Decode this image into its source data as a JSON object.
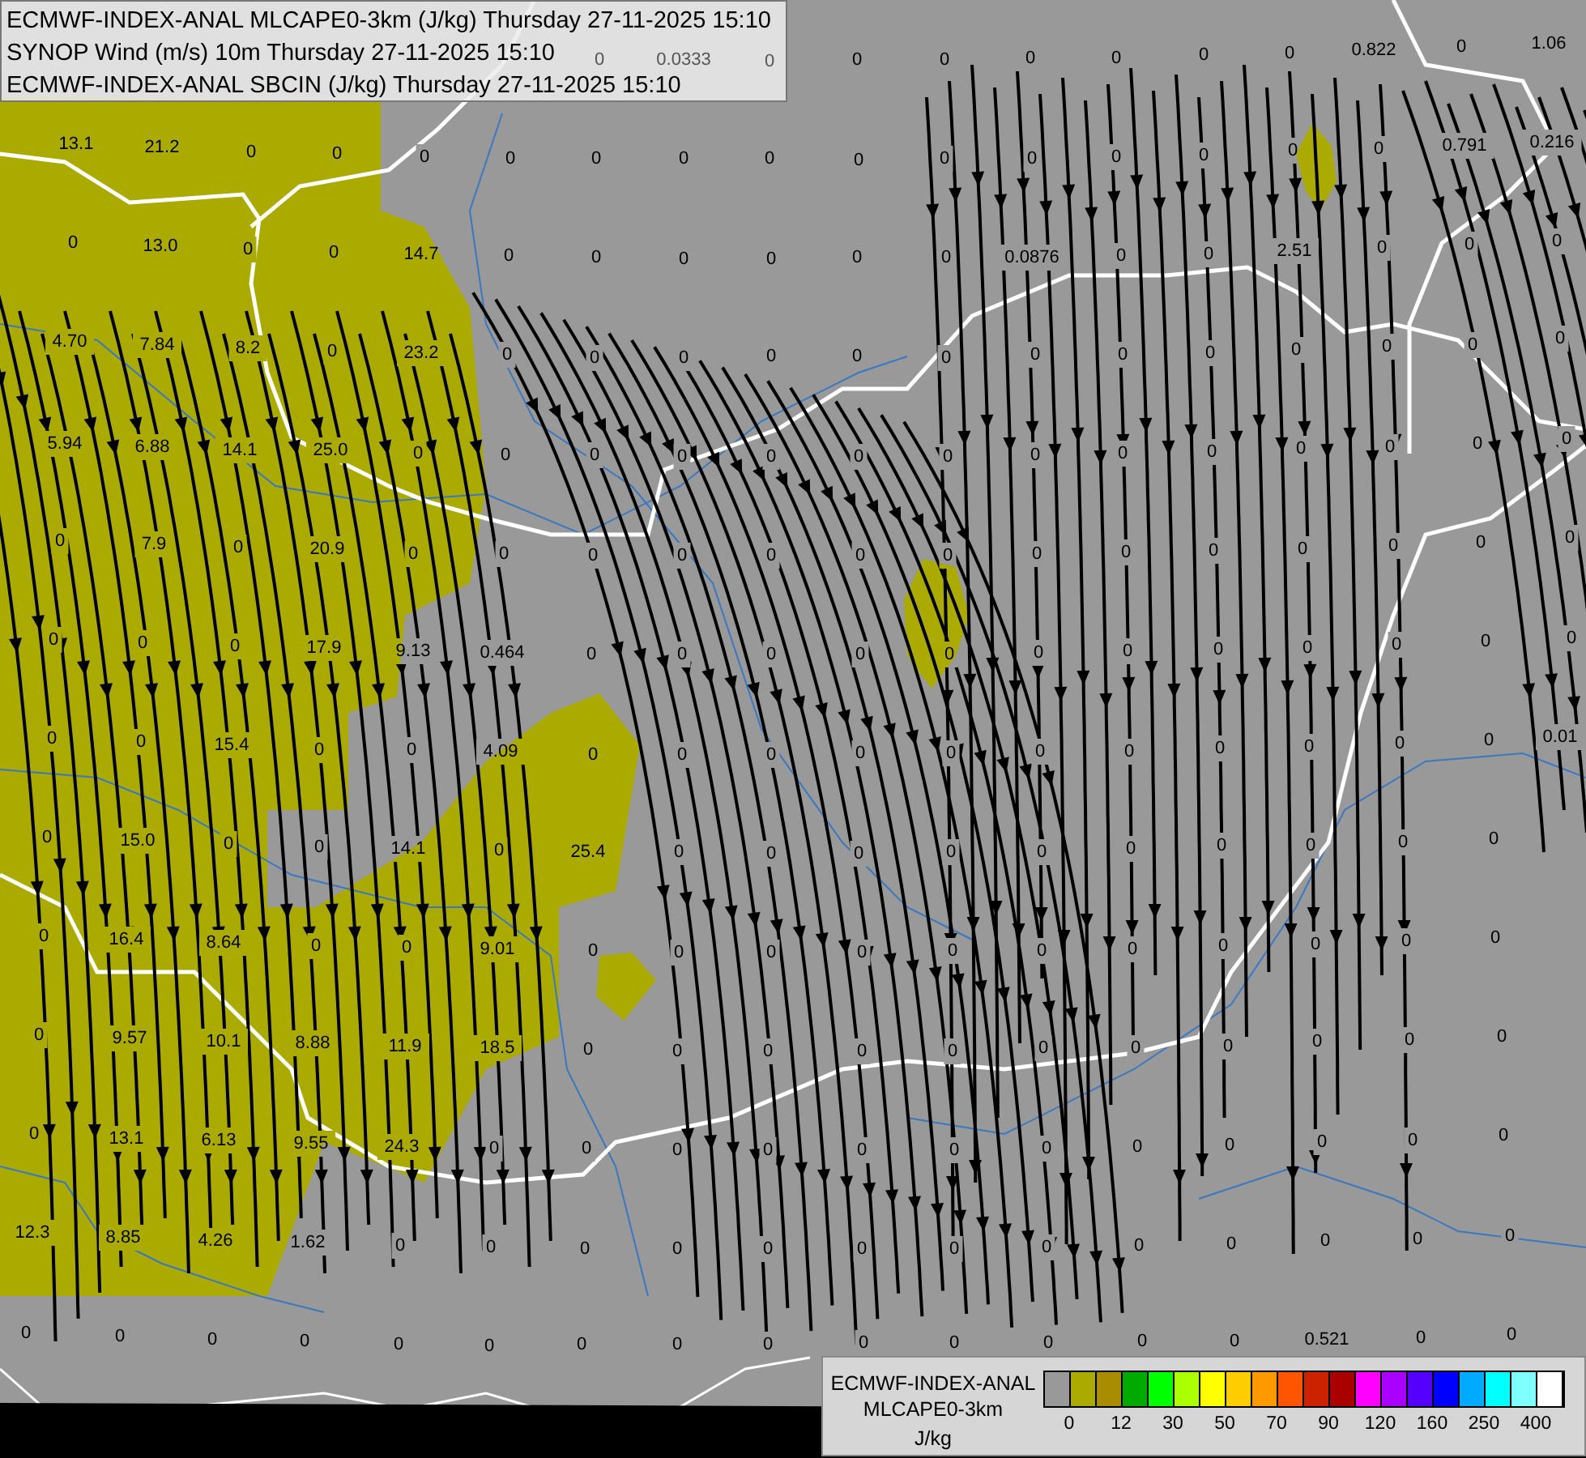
{
  "header": {
    "lines": [
      "ECMWF-INDEX-ANAL MLCAPE0-3km (J/kg) Thursday 27-11-2025 15:10",
      "SYNOP Wind (m/s) 10m Thursday 27-11-2025 15:10",
      "ECMWF-INDEX-ANAL SBCIN (J/kg) Thursday 27-11-2025 15:10"
    ]
  },
  "map": {
    "values": [
      [
        "0",
        "0.0333",
        "0"
      ],
      [
        "0",
        "0",
        "0",
        "0",
        "0",
        "0",
        "0.822",
        "0",
        "1.06"
      ],
      [
        "13.1",
        "21.2",
        "0",
        "0",
        "0",
        "0",
        "0",
        "0",
        "0",
        "0",
        "0",
        "0",
        "0",
        "0",
        "0",
        "0",
        "0.791",
        "0.216"
      ],
      [
        "0",
        "13.0",
        "0",
        "0",
        "14.7",
        "0",
        "0",
        "0",
        "0",
        "0",
        "0",
        "0.0876",
        "0",
        "0",
        "2.51",
        "0",
        "0",
        "0"
      ],
      [
        "4.70",
        "7.84",
        "8.2",
        "0",
        "23.2",
        "0",
        "0",
        "0",
        "0",
        "0",
        "0",
        "0",
        "0",
        "0",
        "0",
        "0",
        "0",
        "0"
      ],
      [
        "5.94",
        "6.88",
        "14.1",
        "25.0",
        "0",
        "0",
        "0",
        "0",
        "0",
        "0",
        "0",
        "0",
        "0",
        "0",
        "0",
        "0",
        "0",
        "0"
      ],
      [
        "0",
        "7.9",
        "0",
        "20.9",
        "0",
        "0",
        "0",
        "0",
        "0",
        "0",
        "0",
        "0",
        "0",
        "0",
        "0",
        "0",
        "0",
        "0"
      ],
      [
        "0",
        "0",
        "0",
        "17.9",
        "9.13",
        "0.464",
        "0",
        "0",
        "0",
        "0",
        "0",
        "0",
        "0",
        "0",
        "0",
        "0",
        "0",
        "0"
      ],
      [
        "0",
        "0",
        "15.4",
        "0",
        "0",
        "4.09",
        "0",
        "0",
        "0",
        "0",
        "0",
        "0",
        "0",
        "0",
        "0",
        "0",
        "0",
        "0.01"
      ],
      [
        "0",
        "15.0",
        "0",
        "0",
        "14.1",
        "0",
        "25.4",
        "0",
        "0",
        "0",
        "0",
        "0",
        "0",
        "0",
        "0",
        "0",
        "0"
      ],
      [
        "0",
        "16.4",
        "8.64",
        "0",
        "0",
        "9.01",
        "0",
        "0",
        "0",
        "0",
        "0",
        "0",
        "0",
        "0",
        "0",
        "0",
        "0"
      ],
      [
        "0",
        "9.57",
        "10.1",
        "8.88",
        "11.9",
        "18.5",
        "0",
        "0",
        "0",
        "0",
        "0",
        "0",
        "0",
        "0",
        "0",
        "0",
        "0"
      ],
      [
        "0",
        "13.1",
        "6.13",
        "9.55",
        "24.3",
        "0",
        "0",
        "0",
        "0",
        "0",
        "0",
        "0",
        "0",
        "0",
        "0",
        "0",
        "0"
      ],
      [
        "12.3",
        "8.85",
        "4.26",
        "1.62",
        "0",
        "0",
        "0",
        "0",
        "0",
        "0",
        "0",
        "0",
        "0",
        "0",
        "0",
        "0",
        "0"
      ],
      [
        "0",
        "0",
        "0",
        "0",
        "0",
        "0",
        "0",
        "0",
        "0",
        "0",
        "0",
        "0",
        "0",
        "0",
        "0.521",
        "0",
        "0"
      ]
    ]
  },
  "legend": {
    "title_lines": [
      "ECMWF-INDEX-ANAL",
      "MLCAPE0-3km"
    ],
    "unit": "J/kg",
    "swatches": [
      {
        "color": "#999999"
      },
      {
        "color": "#aaaa00"
      },
      {
        "color": "#aa8c00"
      },
      {
        "color": "#00aa00"
      },
      {
        "color": "#00ff00"
      },
      {
        "color": "#aaff00"
      },
      {
        "color": "#ffff00"
      },
      {
        "color": "#ffcc00"
      },
      {
        "color": "#ff9900"
      },
      {
        "color": "#ff5500"
      },
      {
        "color": "#cc2200"
      },
      {
        "color": "#aa0000"
      },
      {
        "color": "#ff00ff"
      },
      {
        "color": "#aa00ff"
      },
      {
        "color": "#5500ff"
      },
      {
        "color": "#0000ff"
      },
      {
        "color": "#00aaff"
      },
      {
        "color": "#00ffff"
      },
      {
        "color": "#80ffff"
      },
      {
        "color": "#ffffff"
      }
    ],
    "ticks": [
      "0",
      "12",
      "30",
      "50",
      "70",
      "90",
      "120",
      "160",
      "250",
      "400"
    ]
  }
}
